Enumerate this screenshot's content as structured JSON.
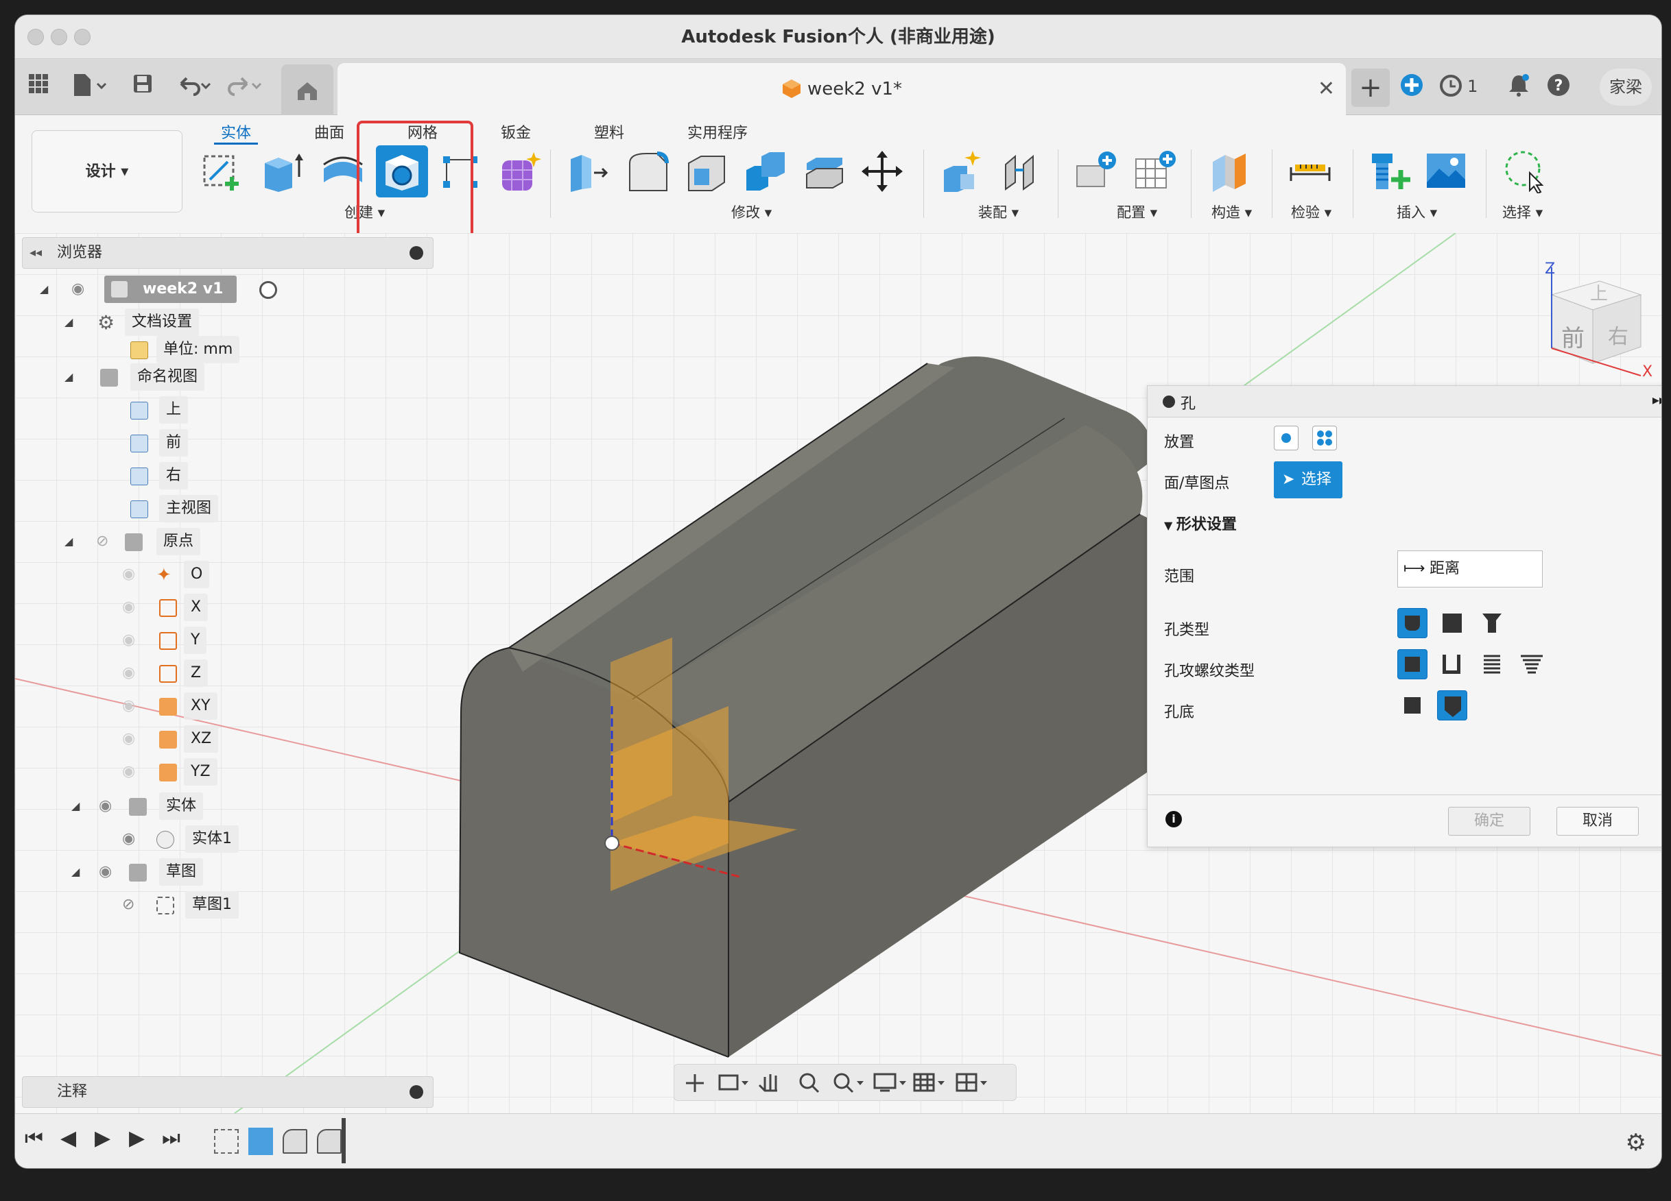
{
  "app": {
    "title": "Autodesk Fusion个人 (非商业用途)"
  },
  "tabbar": {
    "doc_tab_label": "week2 v1*",
    "job_count": "1",
    "user_name": "家梁"
  },
  "ribbon": {
    "design_label": "设计 ▾",
    "tabs": [
      "实体",
      "曲面",
      "网格",
      "钣金",
      "塑料",
      "实用程序"
    ],
    "active_tab": "实体",
    "groups": {
      "create": "创建 ▾",
      "modify": "修改 ▾",
      "assemble": "装配 ▾",
      "configure": "配置 ▾",
      "construct": "构造 ▾",
      "inspect": "检验 ▾",
      "insert": "插入 ▾",
      "select": "选择 ▾"
    },
    "highlight_color": "#e03a3a"
  },
  "browser": {
    "header": "浏览器",
    "root": "week2 v1",
    "doc_settings": "文档设置",
    "units": "单位: mm",
    "named_views": "命名视图",
    "views": [
      "上",
      "前",
      "右",
      "主视图"
    ],
    "origin": "原点",
    "origin_items": [
      "O",
      "X",
      "Y",
      "Z",
      "XY",
      "XZ",
      "YZ"
    ],
    "bodies": "实体",
    "body1": "实体1",
    "sketches": "草图",
    "sketch1": "草图1"
  },
  "notes": {
    "label": "注释"
  },
  "viewcube": {
    "front": "前",
    "right": "右",
    "top": "上",
    "axis_z": "Z",
    "axis_x": "X"
  },
  "hole_panel": {
    "title": "孔",
    "placement": "放置",
    "face_point": "面/草图点",
    "select_label": "选择",
    "shape_settings": "形状设置",
    "extent": "范围",
    "extent_value": "距离",
    "hole_type": "孔类型",
    "tap_type": "孔攻螺纹类型",
    "hole_bottom": "孔底",
    "ok": "确定",
    "cancel": "取消",
    "accent": "#1a8ad4"
  }
}
